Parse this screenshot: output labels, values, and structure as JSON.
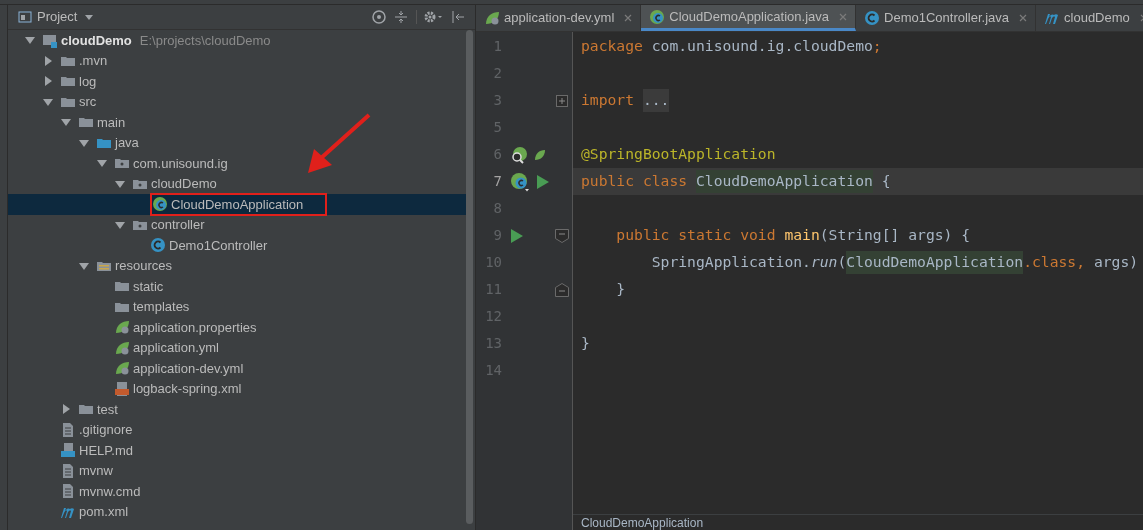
{
  "project_panel": {
    "title": "Project",
    "tree": [
      {
        "label": "cloudDemo",
        "path": "E:\\projects\\cloudDemo",
        "kind": "module",
        "expanded": true,
        "selected": false,
        "children": [
          {
            "label": ".mvn",
            "kind": "folder",
            "expanded": false,
            "selected": false
          },
          {
            "label": "log",
            "kind": "folder",
            "expanded": false,
            "selected": false
          },
          {
            "label": "src",
            "kind": "folder",
            "expanded": true,
            "selected": false,
            "children": [
              {
                "label": "main",
                "kind": "folder",
                "expanded": true,
                "selected": false,
                "children": [
                  {
                    "label": "java",
                    "kind": "source-folder",
                    "expanded": true,
                    "selected": false,
                    "children": [
                      {
                        "label": "com.unisound.ig",
                        "kind": "package",
                        "expanded": true,
                        "selected": false,
                        "children": [
                          {
                            "label": "cloudDemo",
                            "kind": "package",
                            "expanded": true,
                            "selected": false,
                            "children": [
                              {
                                "label": "CloudDemoApplication",
                                "kind": "spring-class",
                                "selected": true,
                                "boxed": true
                              }
                            ]
                          },
                          {
                            "label": "controller",
                            "kind": "package",
                            "expanded": true,
                            "selected": false,
                            "children": [
                              {
                                "label": "Demo1Controller",
                                "kind": "class",
                                "selected": false
                              }
                            ]
                          }
                        ]
                      }
                    ]
                  },
                  {
                    "label": "resources",
                    "kind": "resource-folder",
                    "expanded": true,
                    "selected": false,
                    "children": [
                      {
                        "label": "static",
                        "kind": "leaf-folder",
                        "selected": false
                      },
                      {
                        "label": "templates",
                        "kind": "leaf-folder",
                        "selected": false
                      },
                      {
                        "label": "application.properties",
                        "kind": "spring-file",
                        "selected": false
                      },
                      {
                        "label": "application.yml",
                        "kind": "spring-file",
                        "selected": false
                      },
                      {
                        "label": "application-dev.yml",
                        "kind": "spring-file",
                        "selected": false
                      },
                      {
                        "label": "logback-spring.xml",
                        "kind": "xml-file",
                        "selected": false
                      }
                    ]
                  }
                ]
              },
              {
                "label": "test",
                "kind": "folder",
                "expanded": false,
                "selected": false
              }
            ]
          },
          {
            "label": ".gitignore",
            "kind": "text-file",
            "selected": false
          },
          {
            "label": "HELP.md",
            "kind": "md-file",
            "selected": false
          },
          {
            "label": "mvnw",
            "kind": "text-file",
            "selected": false
          },
          {
            "label": "mvnw.cmd",
            "kind": "text-file",
            "selected": false
          },
          {
            "label": "pom.xml",
            "kind": "maven-file",
            "selected": false
          }
        ]
      }
    ]
  },
  "editor": {
    "tabs": [
      {
        "label": "application-dev.yml",
        "kind": "spring-file",
        "selected": false
      },
      {
        "label": "CloudDemoApplication.java",
        "kind": "spring-class",
        "selected": true
      },
      {
        "label": "Demo1Controller.java",
        "kind": "class",
        "selected": false
      },
      {
        "label": "cloudDemo",
        "kind": "maven-file",
        "selected": false
      }
    ],
    "lines": [
      {
        "number": "1",
        "tokens": [
          {
            "kind": "keyword",
            "text": "package "
          },
          {
            "kind": "plain",
            "text": "com.unisound.ig.cloudDemo"
          },
          {
            "kind": "keyword",
            "text": ";"
          }
        ]
      },
      {
        "number": "2"
      },
      {
        "number": "3",
        "fold": {
          "kind": "plus"
        },
        "tokens": [
          {
            "kind": "keyword",
            "text": "import "
          },
          {
            "kind": "folded",
            "text": "..."
          }
        ]
      },
      {
        "number": "5"
      },
      {
        "number": "6",
        "gutter": [
          {
            "kind": "spring-search"
          },
          {
            "kind": "spring-small"
          }
        ],
        "tokens": [
          {
            "kind": "annotation",
            "text": "@SpringBootApplication"
          }
        ]
      },
      {
        "number": "7",
        "current": true,
        "gutter": [
          {
            "kind": "spring-class"
          },
          {
            "kind": "run"
          }
        ],
        "tokens": [
          {
            "kind": "keyword",
            "text": "public class "
          },
          {
            "kind": "usage",
            "text": "CloudDemoApplication"
          },
          {
            "kind": "plain",
            "text": " {"
          }
        ]
      },
      {
        "number": "8"
      },
      {
        "number": "9",
        "gutter": [
          {
            "kind": "run"
          }
        ],
        "fold": {
          "kind": "open"
        },
        "tokens": [
          {
            "kind": "keyword",
            "text": "    public static void "
          },
          {
            "kind": "method",
            "text": "main"
          },
          {
            "kind": "plain",
            "text": "(String[] args) {"
          }
        ]
      },
      {
        "number": "10",
        "tokens": [
          {
            "kind": "plain",
            "text": "        SpringApplication."
          },
          {
            "kind": "static-call",
            "text": "run"
          },
          {
            "kind": "plain",
            "text": "("
          },
          {
            "kind": "usage",
            "text": "CloudDemoApplication"
          },
          {
            "kind": "keyword",
            "text": ".class, "
          },
          {
            "kind": "plain",
            "text": "args)"
          }
        ]
      },
      {
        "number": "11",
        "fold": {
          "kind": "close"
        },
        "tokens": [
          {
            "kind": "plain",
            "text": "    }"
          }
        ]
      },
      {
        "number": "12"
      },
      {
        "number": "13",
        "tokens": [
          {
            "kind": "plain",
            "text": "}"
          }
        ]
      },
      {
        "number": "14"
      }
    ],
    "breadcrumb": "CloudDemoApplication"
  }
}
